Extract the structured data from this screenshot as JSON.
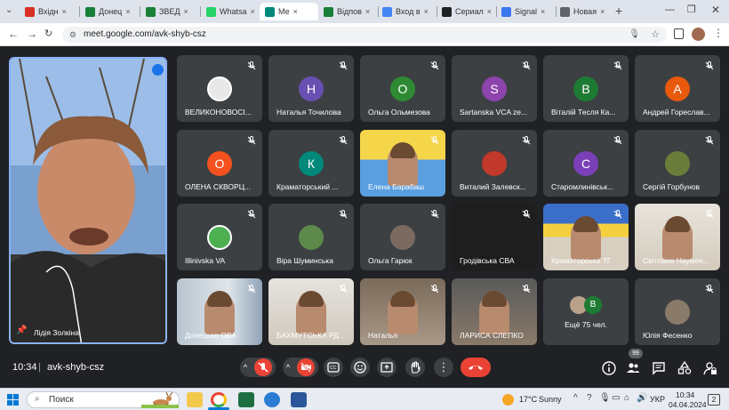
{
  "browser": {
    "tabs": [
      {
        "label": "Вхідн",
        "icon": "gmail-icon",
        "color": "#d93025"
      },
      {
        "label": "Донец",
        "icon": "sheets-icon",
        "color": "#188038"
      },
      {
        "label": "ЗВЕД",
        "icon": "sheets-icon",
        "color": "#188038"
      },
      {
        "label": "Whatsa",
        "icon": "whatsapp-icon",
        "color": "#25d366"
      },
      {
        "label": "Ме",
        "icon": "meet-icon",
        "color": "#00897b"
      },
      {
        "label": "Відпов",
        "icon": "sheets-icon",
        "color": "#188038"
      },
      {
        "label": "Вход в",
        "icon": "apps-icon",
        "color": "#4285f4"
      },
      {
        "label": "Сериал",
        "icon": "hd-icon",
        "color": "#202124"
      },
      {
        "label": "Signal",
        "icon": "signal-icon",
        "color": "#3a76f0"
      },
      {
        "label": "Новая",
        "icon": "chrome-icon",
        "color": "#5f6368"
      }
    ],
    "new_tab": "+",
    "url": "meet.google.com/avk-shyb-csz"
  },
  "main_speaker": {
    "name": "Лідія Золкіна"
  },
  "participants": [
    {
      "name": "ВЕЛИКОНОВОСІ...",
      "kind": "logo",
      "color": "#e8e8e8"
    },
    {
      "name": "Наталья Точилова",
      "kind": "letter",
      "letter": "Н",
      "color": "#6a4fb3"
    },
    {
      "name": "Ольга Ольмезова",
      "kind": "letter",
      "letter": "О",
      "color": "#2e8b33"
    },
    {
      "name": "Sartanska VCA ze...",
      "kind": "letter",
      "letter": "S",
      "color": "#8e44ad"
    },
    {
      "name": "Віталій Тесля Ка...",
      "kind": "letter",
      "letter": "В",
      "color": "#1e7b34"
    },
    {
      "name": "Андрей Гореслав...",
      "kind": "letter",
      "letter": "А",
      "color": "#e8590c"
    },
    {
      "name": "ОЛЕНА СКВОРЦ...",
      "kind": "letter",
      "letter": "О",
      "color": "#f4511e"
    },
    {
      "name": "Краматорський ...",
      "kind": "letter",
      "letter": "К",
      "color": "#00897b"
    },
    {
      "name": "Елена Барабаш",
      "kind": "video"
    },
    {
      "name": "Виталий Залевск...",
      "kind": "photo",
      "color": "#c0392b"
    },
    {
      "name": "Старомлинівськ...",
      "kind": "letter",
      "letter": "С",
      "color": "#7b3fb8"
    },
    {
      "name": "Сергій Горбунов",
      "kind": "photo",
      "color": "#6b7d3a"
    },
    {
      "name": "Illinivska VA",
      "kind": "logo",
      "color": "#4caf50"
    },
    {
      "name": "Віра Шуминська",
      "kind": "photo",
      "color": "#5d8a4a"
    },
    {
      "name": "Ольга Гарюк",
      "kind": "photo",
      "color": "#7a6a60"
    },
    {
      "name": "Гродівська СВА",
      "kind": "dark"
    },
    {
      "name": "Краматорська ТГ",
      "kind": "video"
    },
    {
      "name": "Світлана Наумен...",
      "kind": "video"
    },
    {
      "name": "Донецька ОВА",
      "kind": "video"
    },
    {
      "name": "БАХМУТСЬКА РД...",
      "kind": "video"
    },
    {
      "name": "Наталья",
      "kind": "video"
    },
    {
      "name": "ЛАРИСА СЛЕПКО",
      "kind": "video"
    },
    {
      "name": "Ещё 75 чел.",
      "kind": "more"
    },
    {
      "name": "Юлія Фесенко",
      "kind": "photo",
      "color": "#8a7a6a"
    }
  ],
  "more": {
    "badge": "В"
  },
  "bottom": {
    "time": "10:34",
    "separator": "|",
    "code": "avk-shyb-csz",
    "participants_count": "99"
  },
  "taskbar": {
    "search": "Поиск",
    "weather_temp": "17°C",
    "weather_text": "Sunny",
    "lang": "УКР",
    "time": "10:34",
    "date": "04.04.2024",
    "notif": "2"
  }
}
